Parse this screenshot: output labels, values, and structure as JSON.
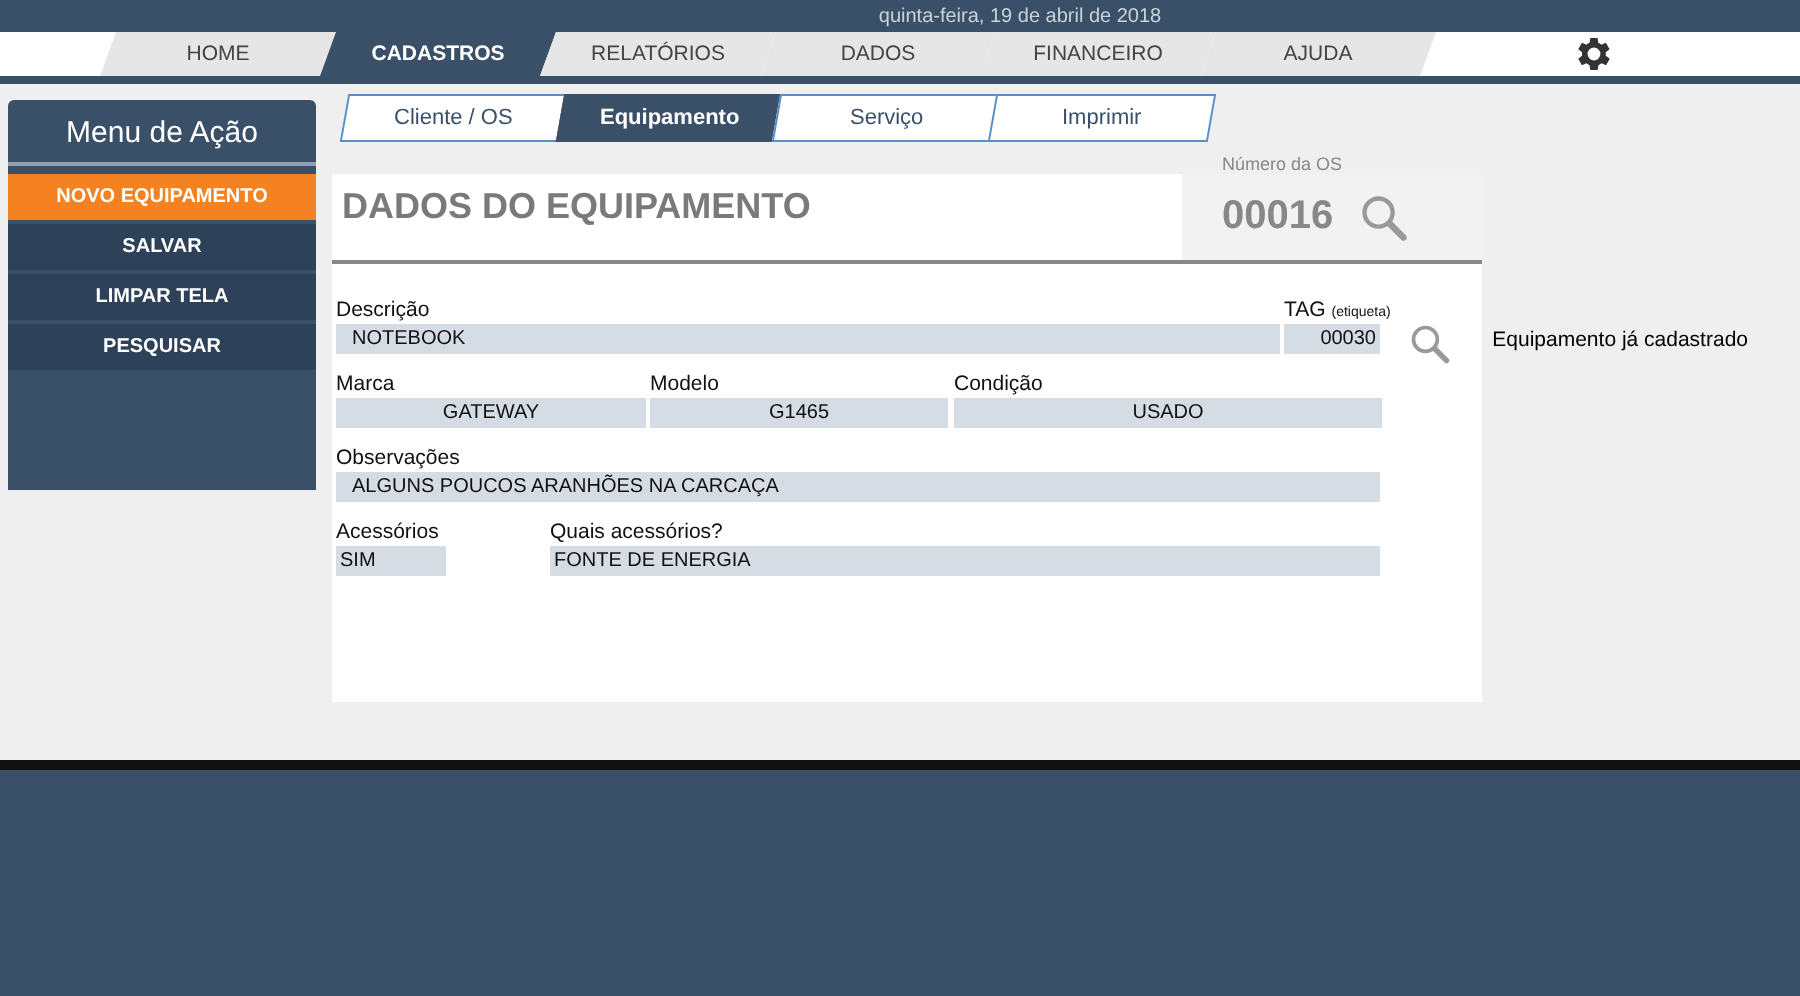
{
  "date": "quinta-feira, 19 de abril de 2018",
  "nav": [
    {
      "label": "HOME",
      "selected": false
    },
    {
      "label": "CADASTROS",
      "selected": true
    },
    {
      "label": "RELATÓRIOS",
      "selected": false
    },
    {
      "label": "DADOS",
      "selected": false
    },
    {
      "label": "FINANCEIRO",
      "selected": false
    },
    {
      "label": "AJUDA",
      "selected": false
    }
  ],
  "action_menu": {
    "title": "Menu de Ação",
    "items": [
      {
        "label": "NOVO EQUIPAMENTO",
        "selected": true
      },
      {
        "label": "SALVAR",
        "selected": false
      },
      {
        "label": "LIMPAR TELA",
        "selected": false
      },
      {
        "label": "PESQUISAR",
        "selected": false
      }
    ]
  },
  "subtabs": [
    {
      "label": "Cliente / OS",
      "selected": false
    },
    {
      "label": "Equipamento",
      "selected": true
    },
    {
      "label": "Serviço",
      "selected": false
    },
    {
      "label": "Imprimir",
      "selected": false
    }
  ],
  "form": {
    "title": "DADOS DO EQUIPAMENTO",
    "os_label": "Número da OS",
    "os_number": "00016",
    "description": {
      "label": "Descrição",
      "value": "NOTEBOOK"
    },
    "tag": {
      "label": "TAG",
      "note": "(etiqueta)",
      "value": "00030"
    },
    "status": "Equipamento já cadastrado",
    "brand": {
      "label": "Marca",
      "value": "GATEWAY"
    },
    "model": {
      "label": "Modelo",
      "value": "G1465"
    },
    "condition": {
      "label": "Condição",
      "value": "USADO"
    },
    "notes": {
      "label": "Observações",
      "value": "ALGUNS POUCOS ARANHÕES NA CARCAÇA"
    },
    "accessories": {
      "label": "Acessórios",
      "value": "SIM"
    },
    "which_accessories": {
      "label": "Quais acessórios?",
      "value": "FONTE DE ENERGIA"
    }
  }
}
